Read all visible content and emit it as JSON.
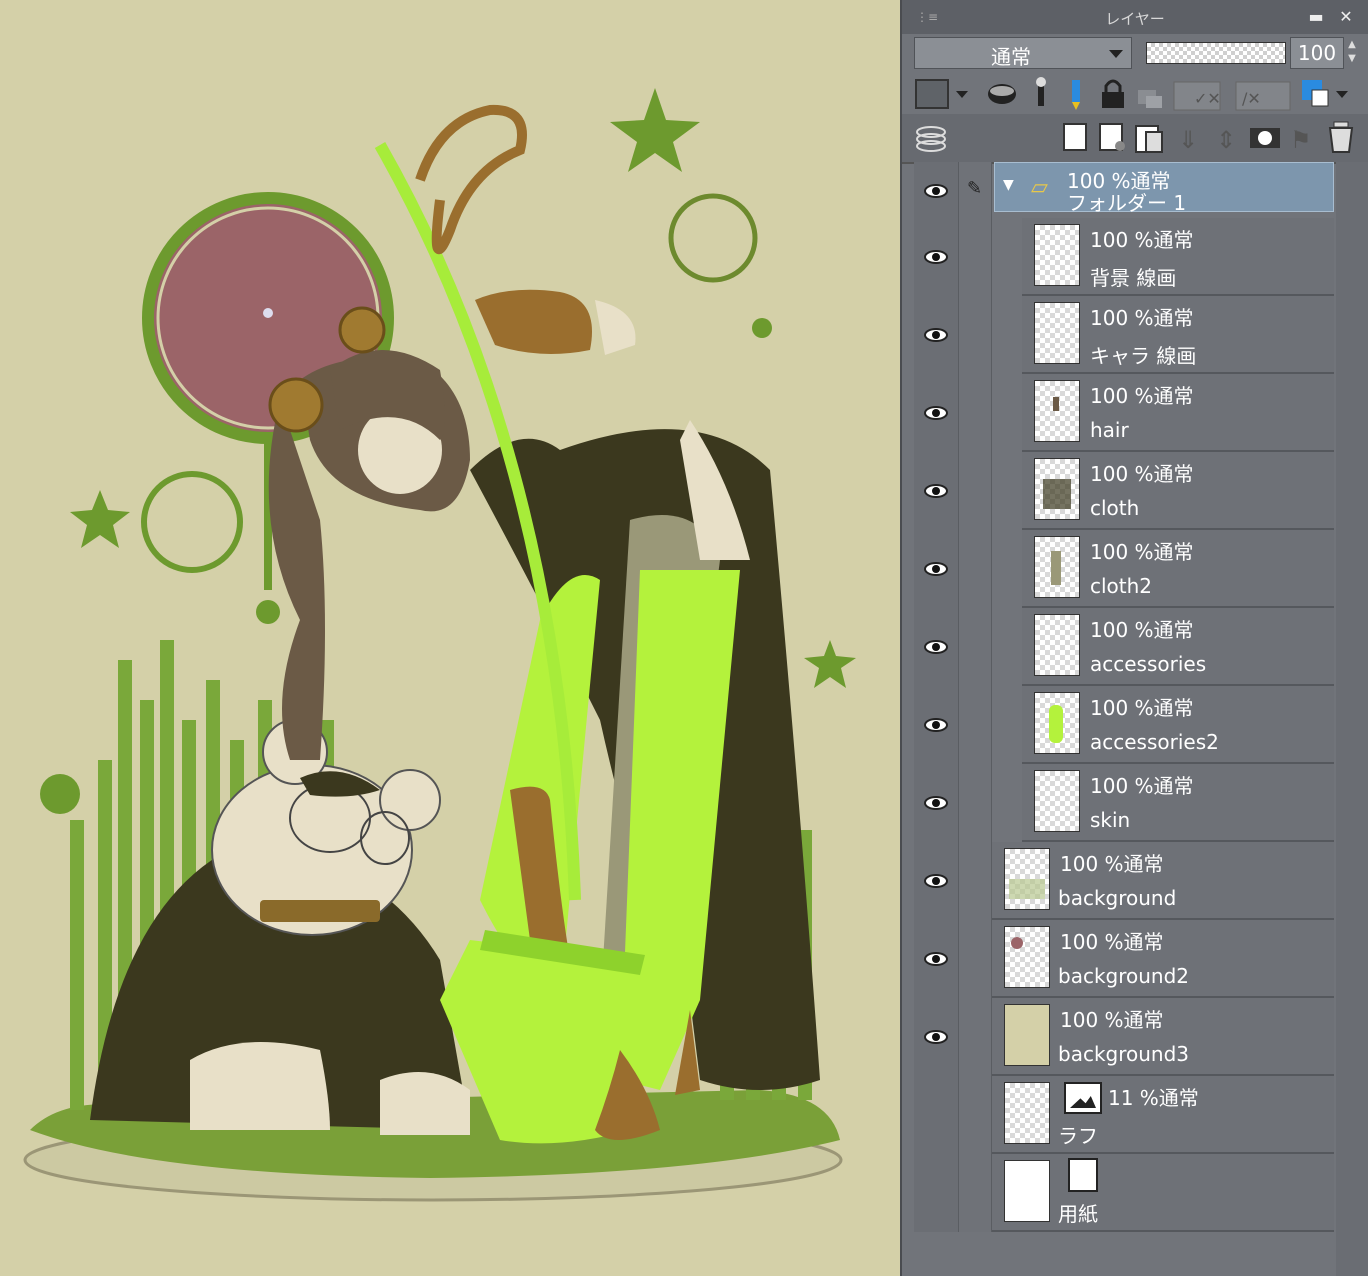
{
  "panel": {
    "title": "レイヤー",
    "blend_mode": "通常",
    "opacity_value": "100",
    "icons": [
      "layer-panel-grip-icon",
      "minimize-icon",
      "close-icon",
      "layer-color-icon",
      "clip-icon",
      "reference-icon",
      "lock-icon",
      "lock-alpha-icon",
      "mask-enable-icon",
      "ruler-range-icon",
      "layer-color-select-icon",
      "new-raster-layer-icon",
      "new-vector-layer-icon",
      "new-folder-icon",
      "transfer-down-icon",
      "merge-down-icon",
      "mask-icon",
      "create-mask-icon",
      "delete-layer-icon"
    ]
  },
  "layers": [
    {
      "mode": "100 %通常",
      "name": "フォルダー 1",
      "type": "folder",
      "visible": true,
      "selected": true
    },
    {
      "mode": "100 %通常",
      "name": "背景 線画",
      "type": "raster",
      "visible": true
    },
    {
      "mode": "100 %通常",
      "name": "キャラ 線画",
      "type": "raster",
      "visible": true
    },
    {
      "mode": "100 %通常",
      "name": "hair",
      "type": "raster",
      "visible": true
    },
    {
      "mode": "100 %通常",
      "name": "cloth",
      "type": "raster",
      "visible": true
    },
    {
      "mode": "100 %通常",
      "name": "cloth2",
      "type": "raster",
      "visible": true
    },
    {
      "mode": "100 %通常",
      "name": "accessories",
      "type": "raster",
      "visible": true
    },
    {
      "mode": "100 %通常",
      "name": "accessories2",
      "type": "raster",
      "visible": true
    },
    {
      "mode": "100 %通常",
      "name": "skin",
      "type": "raster",
      "visible": true
    },
    {
      "mode": "100 %通常",
      "name": "background",
      "type": "raster",
      "visible": true
    },
    {
      "mode": "100 %通常",
      "name": "background2",
      "type": "raster",
      "visible": true
    },
    {
      "mode": "100 %通常",
      "name": "background3",
      "type": "raster",
      "visible": true
    },
    {
      "mode": "11 %通常",
      "name": "ラフ",
      "type": "image",
      "visible": false
    },
    {
      "mode": "",
      "name": "用紙",
      "type": "paper",
      "visible": false
    }
  ],
  "colors": {
    "canvas_bg": "#d4d0a8",
    "panel_bg": "#71747a",
    "selected_layer": "#7d96ad",
    "accent_green": "#9acd32",
    "dark_cloth": "#3d3a1e",
    "circle_fill": "#9b6468"
  }
}
